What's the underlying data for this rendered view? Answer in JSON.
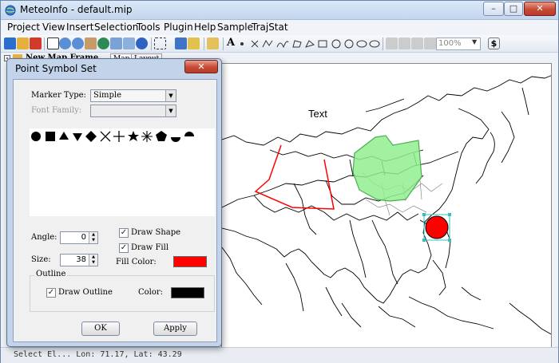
{
  "window": {
    "title": "MeteoInfo - default.mip",
    "minimize": "–",
    "maximize": "□",
    "close": "✕"
  },
  "menus": [
    "Project",
    "View",
    "Insert",
    "Selection",
    "Tools",
    "Plugin",
    "Help",
    "Sample",
    "TrajStat"
  ],
  "toolbar": {
    "zoom_value": "100%",
    "text_tool": "A",
    "dollar_icon": "$"
  },
  "left_panel": {
    "header": "New Map Frame"
  },
  "tabs": [
    "Map",
    "Layout"
  ],
  "map": {
    "text_label": "Text",
    "colors": {
      "polygon_fill": "#90ee90",
      "polyline": "#ff0000",
      "marker": "#ff0000",
      "selection": "#35c0c0"
    }
  },
  "status": {
    "text": "Select El...   Lon: 71.17, Lat: 43.29"
  },
  "dialog": {
    "title": "Point Symbol Set",
    "close_label": "✕",
    "marker_type_label": "Marker Type:",
    "marker_type_value": "Simple",
    "font_family_label": "Font Family:",
    "font_family_value": "",
    "angle_label": "Angle:",
    "angle_value": "0",
    "size_label": "Size:",
    "size_value": "38",
    "draw_shape_label": "Draw Shape",
    "draw_shape_checked": true,
    "draw_fill_label": "Draw Fill",
    "draw_fill_checked": true,
    "fill_color_label": "Fill Color:",
    "fill_color": "#ff0000",
    "outline_group_label": "Outline",
    "draw_outline_label": "Draw Outline",
    "draw_outline_checked": true,
    "outline_color_label": "Color:",
    "outline_color": "#000000",
    "ok_label": "OK",
    "apply_label": "Apply",
    "symbols": [
      "circle",
      "square",
      "triangle-up",
      "triangle-down",
      "diamond",
      "x-cross",
      "plus",
      "star",
      "asterisk",
      "pentagon",
      "lower-half-circle",
      "upper-half-circle"
    ]
  }
}
